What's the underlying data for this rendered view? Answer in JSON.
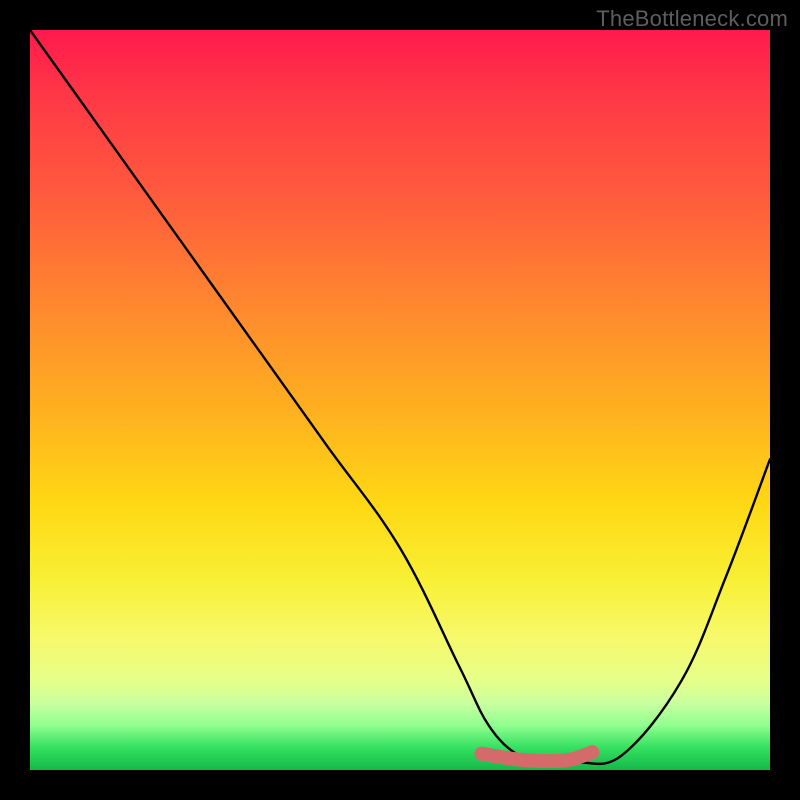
{
  "watermark": "TheBottleneck.com",
  "chart_data": {
    "type": "line",
    "title": "",
    "xlabel": "",
    "ylabel": "",
    "xlim": [
      0,
      100
    ],
    "ylim": [
      0,
      100
    ],
    "series": [
      {
        "name": "bottleneck-curve",
        "x": [
          0,
          10,
          20,
          30,
          40,
          50,
          58,
          62,
          66,
          70,
          74,
          80,
          88,
          94,
          100
        ],
        "values": [
          100,
          86,
          72,
          58,
          44,
          30,
          14,
          6,
          2,
          1,
          1,
          2,
          12,
          26,
          42
        ]
      },
      {
        "name": "highlight-flat",
        "x": [
          61,
          66,
          70,
          73,
          76
        ],
        "values": [
          2.2,
          1.4,
          1.2,
          1.4,
          2.4
        ]
      }
    ],
    "annotations": [],
    "legend": false,
    "grid": false,
    "background_gradient": {
      "stops": [
        {
          "pos": 0,
          "color": "#ff1a4d"
        },
        {
          "pos": 50,
          "color": "#ffb21f"
        },
        {
          "pos": 80,
          "color": "#f7f96a"
        },
        {
          "pos": 95,
          "color": "#33e060"
        },
        {
          "pos": 100,
          "color": "#15b84a"
        }
      ]
    }
  }
}
